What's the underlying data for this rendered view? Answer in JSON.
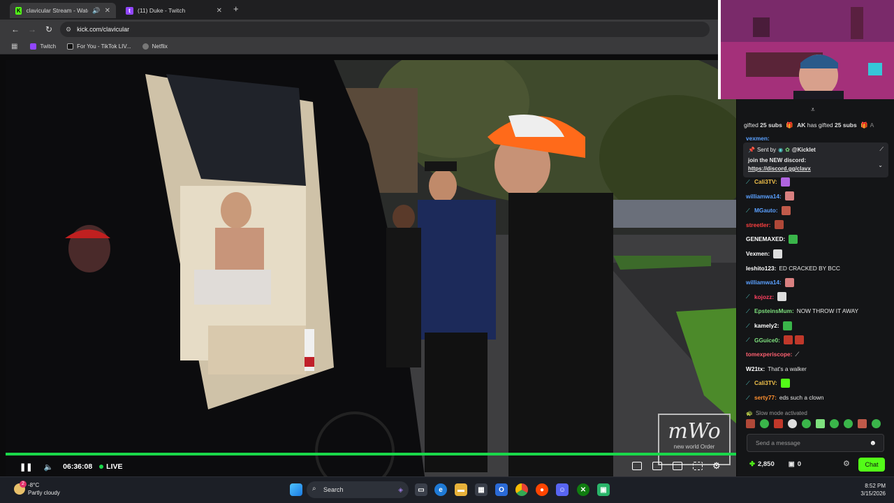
{
  "browser": {
    "tabs": [
      {
        "title": "clavicular Stream - Watch L",
        "favicon": "kick-icon",
        "active": true
      },
      {
        "title": "(11) Duke - Twitch",
        "favicon": "twitch-icon",
        "active": false
      }
    ],
    "new_tab": "+",
    "url": "kick.com/clavicular",
    "bookmarks": [
      {
        "label": "Twitch",
        "color": "#9146ff"
      },
      {
        "label": "For You - TikTok LIV...",
        "color": "#111111"
      },
      {
        "label": "Netflix",
        "color": "#777777"
      }
    ]
  },
  "player": {
    "elapsed": "06:36:08",
    "live_label": "LIVE",
    "watermark": "mWo",
    "watermark_sub": "new world Order",
    "accent": "#1ad84a"
  },
  "chat": {
    "gift_banner": {
      "prefix": "gifted ",
      "count_1": "25 subs",
      "user": "AK",
      "mid": " has gifted ",
      "count_2": "25 subs",
      "tail": "A"
    },
    "top_user": "vexmen:",
    "pinned": {
      "sent_by_label": "Sent by",
      "sender": "@Kicklet",
      "text": "join the NEW discord:",
      "link": "https://discord.gg/clavx"
    },
    "messages": [
      {
        "user": "Cali3TV:",
        "color": "#f0c04a",
        "badge": true,
        "text": "",
        "emotes": [
          "#b064e0"
        ]
      },
      {
        "user": "williamwa14:",
        "color": "#5aa0ff",
        "badge": false,
        "text": "",
        "emotes": [
          "#d98080"
        ]
      },
      {
        "user": "MGauto:",
        "color": "#5aa0ff",
        "badge": true,
        "text": "",
        "emotes": [
          "#c05a4a"
        ]
      },
      {
        "user": "streetler:",
        "color": "#ff4040",
        "badge": false,
        "text": "",
        "emotes": [
          "#b04838"
        ]
      },
      {
        "user": "GENEMAXED:",
        "color": "#ffffff",
        "badge": false,
        "text": "",
        "emotes": [
          "#3ab54a"
        ]
      },
      {
        "user": "Vexmen:",
        "color": "#ffffff",
        "badge": false,
        "text": "",
        "emotes": [
          "#dddddd"
        ]
      },
      {
        "user": "leshito123:",
        "color": "#ffffff",
        "badge": false,
        "text": "ED CRACKED BY BCC",
        "emotes": []
      },
      {
        "user": "williamwa14:",
        "color": "#5aa0ff",
        "badge": false,
        "text": "",
        "emotes": [
          "#d98080"
        ]
      },
      {
        "user": "kojozz:",
        "color": "#ff4060",
        "badge": true,
        "text": "",
        "emotes": [
          "#dddddd"
        ]
      },
      {
        "user": "EpsteinsMum:",
        "color": "#7ee07e",
        "badge": true,
        "text": "NOW THROW IT AWAY",
        "emotes": []
      },
      {
        "user": "kamely2:",
        "color": "#ffffff",
        "badge": true,
        "text": "",
        "emotes": [
          "#3ab54a"
        ]
      },
      {
        "user": "GGuice0:",
        "color": "#7ee07e",
        "badge": true,
        "text": "",
        "emotes": [
          "#c0382a",
          "#c0382a"
        ]
      },
      {
        "user": "tomexperiscope:",
        "color": "#ff6070",
        "badge": false,
        "text": "⟋",
        "emotes": []
      },
      {
        "user": "W21tx:",
        "color": "#ffffff",
        "badge": false,
        "text": "That's a walker",
        "emotes": []
      },
      {
        "user": "Cali3TV:",
        "color": "#f0c04a",
        "badge": true,
        "text": "",
        "emotes": [
          "#53fc18"
        ]
      },
      {
        "user": "serty77:",
        "color": "#ff9030",
        "badge": true,
        "text": "eds such a clown",
        "emotes": []
      }
    ],
    "slow_mode": "Slow mode activated",
    "input_placeholder": "Send a message",
    "points": "2,850",
    "gifts": "0",
    "send_label": "Chat",
    "accent": "#53fc18"
  },
  "taskbar": {
    "weather_temp": "-8°C",
    "weather_desc": "Partly cloudy",
    "weather_badge": "2",
    "search_label": "Search",
    "time": "8:52 PM",
    "date": "3/15/2026"
  }
}
